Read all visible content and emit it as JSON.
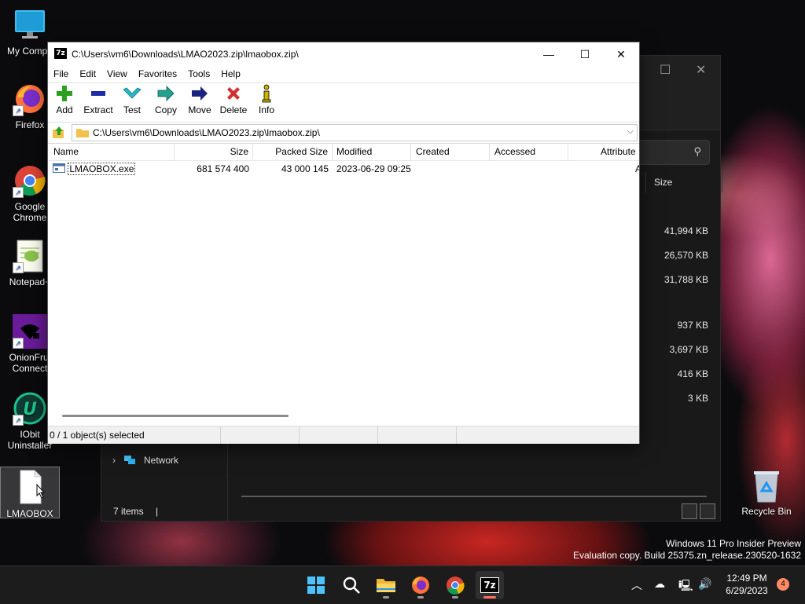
{
  "desktop": {
    "icons": [
      {
        "label": "My Compu",
        "icon": "monitor-icon"
      },
      {
        "label": "Firefox",
        "icon": "firefox-icon"
      },
      {
        "label": "Google Chrome",
        "icon": "chrome-icon"
      },
      {
        "label": "Notepad+",
        "icon": "notepad-plus-plus-icon"
      },
      {
        "label": "OnionFrui Connect",
        "icon": "onionfruit-icon"
      },
      {
        "label": "IObit Uninstaller",
        "icon": "iobit-uninstaller-icon"
      },
      {
        "label": "LMAOBOX",
        "icon": "blank-file-icon"
      }
    ],
    "recycle_bin_label": "Recycle Bin"
  },
  "explorer": {
    "size_header": "Size",
    "sizes": [
      "41,994 KB",
      "26,570 KB",
      "31,788 KB",
      "937 KB",
      "3,697 KB",
      "416 KB",
      "3 KB"
    ],
    "network_label": "Network",
    "status": "7 items",
    "status_sep": "|"
  },
  "sevenzip": {
    "app_icon_text": "7z",
    "title": "C:\\Users\\vm6\\Downloads\\LMAO2023.zip\\lmaobox.zip\\",
    "menu": [
      "File",
      "Edit",
      "View",
      "Favorites",
      "Tools",
      "Help"
    ],
    "toolbar": [
      {
        "label": "Add",
        "icon": "plus-icon",
        "color": "#2aa01e"
      },
      {
        "label": "Extract",
        "icon": "minus-icon",
        "color": "#1f2aa8"
      },
      {
        "label": "Test",
        "icon": "check-icon",
        "color": "#27b7c4"
      },
      {
        "label": "Copy",
        "icon": "copy-arrow-icon",
        "color": "#22a08c"
      },
      {
        "label": "Move",
        "icon": "move-arrow-icon",
        "color": "#1a237e"
      },
      {
        "label": "Delete",
        "icon": "x-icon",
        "color": "#d32f2f"
      },
      {
        "label": "Info",
        "icon": "info-icon",
        "color": "#c9b400"
      }
    ],
    "address": "C:\\Users\\vm6\\Downloads\\LMAO2023.zip\\lmaobox.zip\\",
    "columns": [
      "Name",
      "Size",
      "Packed Size",
      "Modified",
      "Created",
      "Accessed",
      "Attribute"
    ],
    "files": [
      {
        "name": "LMAOBOX.exe",
        "size": "681 574 400",
        "packed": "43 000 145",
        "modified": "2023-06-29 09:25",
        "created": "",
        "accessed": "",
        "attr": "A"
      }
    ],
    "status": "0 / 1 object(s) selected"
  },
  "watermark": {
    "line1": "Windows 11 Pro Insider Preview",
    "line2": "Evaluation copy. Build 25375.zn_release.230520-1632"
  },
  "taskbar": {
    "time": "12:49 PM",
    "date": "6/29/2023",
    "notifications": "4",
    "apps": [
      "start-icon",
      "search-icon",
      "file-explorer-icon",
      "firefox-icon",
      "chrome-icon",
      "7zip-icon"
    ]
  }
}
